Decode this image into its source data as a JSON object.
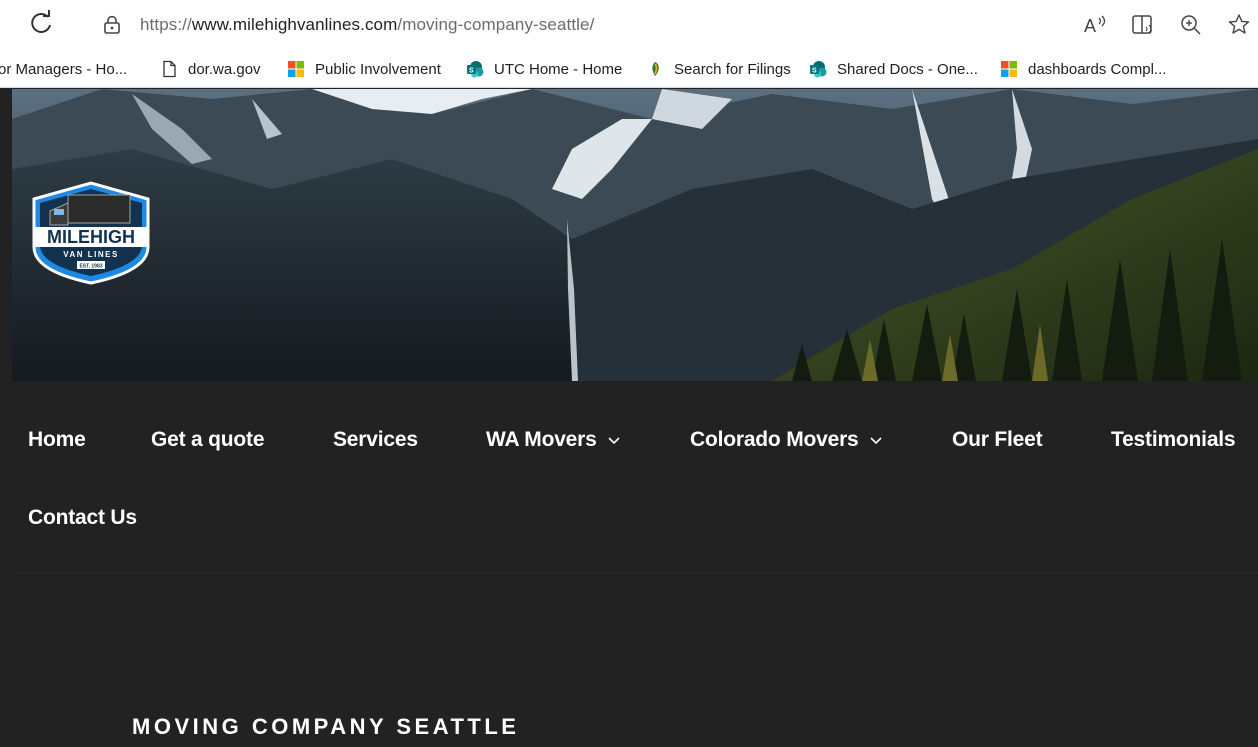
{
  "browser": {
    "url_prefix": "https://",
    "url_domain": "www.milehighvanlines.com",
    "url_path": "/moving-company-seattle/"
  },
  "bookmarks": [
    {
      "label": "or Managers - Ho...",
      "icon": "none"
    },
    {
      "label": "dor.wa.gov",
      "icon": "page-icon"
    },
    {
      "label": "Public Involvement",
      "icon": "windows-tiles-icon"
    },
    {
      "label": "UTC Home - Home",
      "icon": "sharepoint-icon"
    },
    {
      "label": "Search for Filings",
      "icon": "feather-icon"
    },
    {
      "label": "Shared Docs - One...",
      "icon": "sharepoint-icon"
    },
    {
      "label": "dashboards Compl...",
      "icon": "windows-tiles-icon"
    }
  ],
  "logo": {
    "brand": "MILEHIGH",
    "tagline": "VAN LINES",
    "est": "EST. 1983"
  },
  "nav": {
    "items": [
      {
        "label": "Home"
      },
      {
        "label": "Get a quote"
      },
      {
        "label": "Services"
      },
      {
        "label": "WA Movers",
        "dropdown": true
      },
      {
        "label": "Colorado Movers",
        "dropdown": true
      },
      {
        "label": "Our Fleet"
      },
      {
        "label": "Testimonials"
      },
      {
        "label": "Contact Us"
      }
    ]
  },
  "page": {
    "title": "MOVING COMPANY SEATTLE"
  },
  "colors": {
    "nav_bg": "#222222",
    "logo_blue": "#1e88e5",
    "text": "#ffffff"
  }
}
